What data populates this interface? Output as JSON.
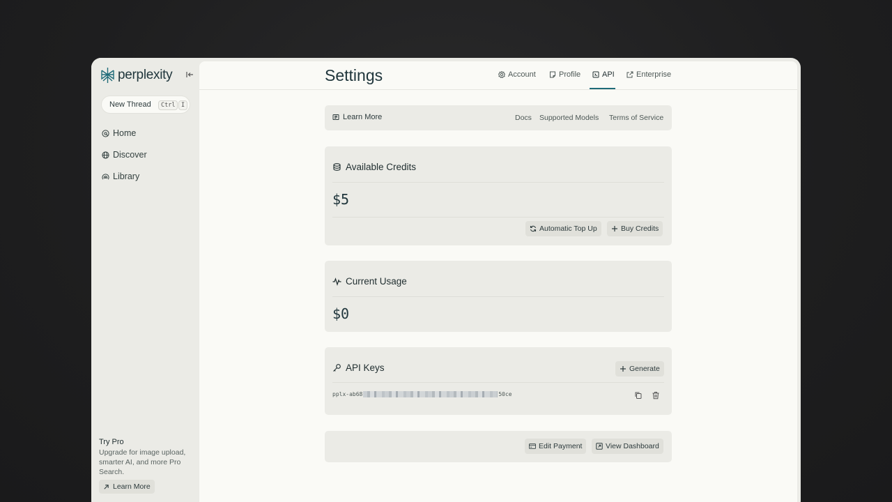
{
  "app": {
    "name": "perplexity"
  },
  "sidebar": {
    "new_thread": {
      "label": "New Thread",
      "shortcut_ctrl": "Ctrl",
      "shortcut_key": "I"
    },
    "nav": [
      {
        "label": "Home",
        "icon": "home-icon"
      },
      {
        "label": "Discover",
        "icon": "globe-icon"
      },
      {
        "label": "Library",
        "icon": "library-icon"
      }
    ],
    "promo": {
      "title": "Try Pro",
      "description": "Upgrade for image upload, smarter AI, and more Pro Search.",
      "button_label": "Learn More"
    }
  },
  "header": {
    "title": "Settings",
    "tabs": [
      {
        "label": "Account",
        "icon": "gear-icon"
      },
      {
        "label": "Profile",
        "icon": "profile-icon"
      },
      {
        "label": "API",
        "icon": "api-icon",
        "active": true
      },
      {
        "label": "Enterprise",
        "icon": "external-link-icon"
      }
    ]
  },
  "links_bar": {
    "learn_more": "Learn More",
    "docs": "Docs",
    "supported_models": "Supported Models",
    "terms": "Terms of Service"
  },
  "credits": {
    "title": "Available Credits",
    "value": "$5",
    "auto_topup_label": "Automatic Top Up",
    "buy_label": "Buy Credits"
  },
  "usage": {
    "title": "Current Usage",
    "value": "$0"
  },
  "api_keys": {
    "title": "API Keys",
    "generate_label": "Generate",
    "key_prefix": "pplx-ab68",
    "key_suffix": "50ce"
  },
  "billing": {
    "edit_payment_label": "Edit Payment",
    "view_dashboard_label": "View Dashboard"
  },
  "colors": {
    "accent": "#1f6b78",
    "background": "#1e1e1f",
    "panel": "#ebebe6",
    "main": "#fafaf6"
  }
}
